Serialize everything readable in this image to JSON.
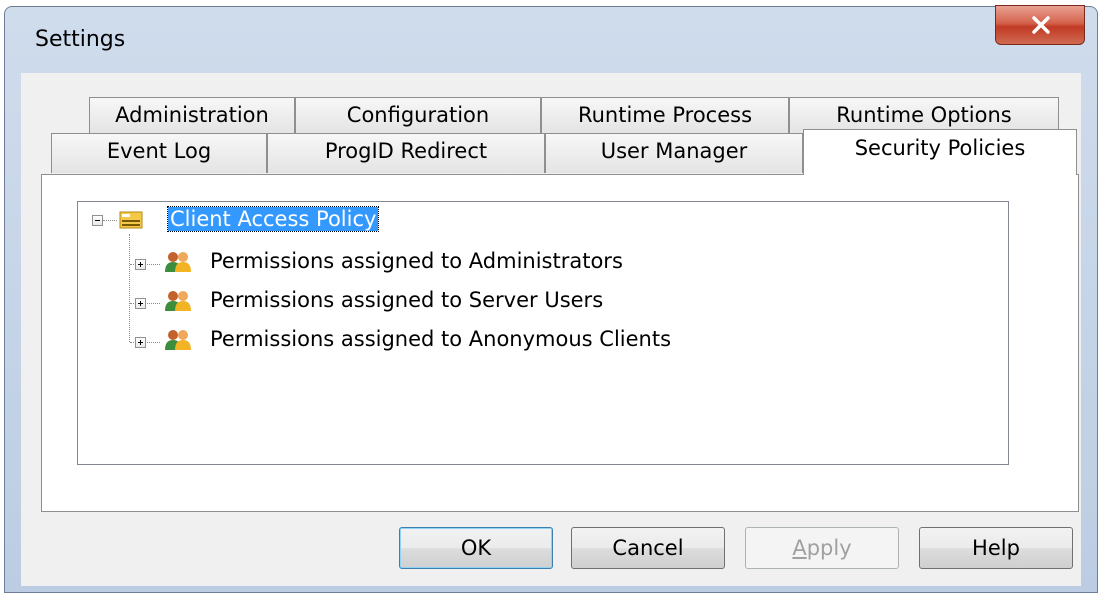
{
  "window": {
    "title": "Settings"
  },
  "tabs": {
    "row1": [
      "Administration",
      "Configuration",
      "Runtime Process",
      "Runtime Options"
    ],
    "row2": [
      "Event Log",
      "ProgID Redirect",
      "User Manager",
      "Security Policies"
    ],
    "active": "Security Policies"
  },
  "tree": {
    "root": {
      "label": "Client Access Policy",
      "icon": "policy-key-icon",
      "expanded": true,
      "selected": true
    },
    "children": [
      {
        "label": "Permissions assigned to Administrators",
        "icon": "users-group-icon",
        "expanded": false
      },
      {
        "label": "Permissions assigned to Server Users",
        "icon": "users-group-icon",
        "expanded": false
      },
      {
        "label": "Permissions assigned to Anonymous Clients",
        "icon": "users-group-icon",
        "expanded": false
      }
    ]
  },
  "buttons": {
    "ok": "OK",
    "cancel": "Cancel",
    "apply_mnemonic": "A",
    "apply_rest": "pply",
    "help": "Help"
  },
  "colors": {
    "selection": "#3399ff",
    "close": "#c13a24"
  }
}
